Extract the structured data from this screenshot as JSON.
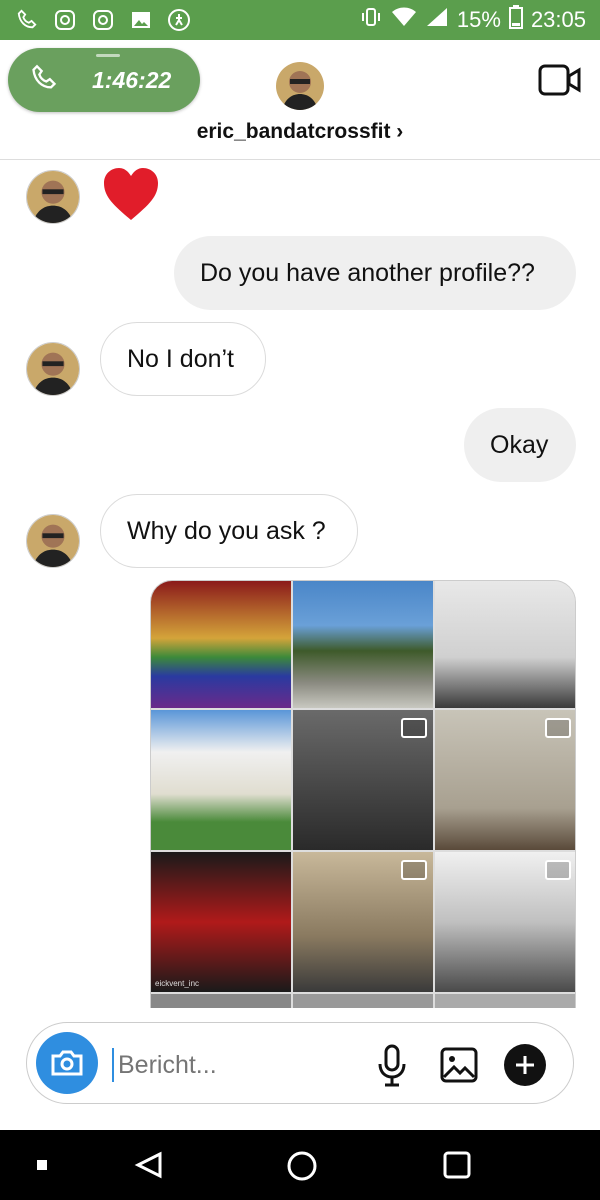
{
  "status_bar": {
    "battery": "15%",
    "time": "23:05",
    "icons": [
      "phone-icon",
      "instagram-icon",
      "instagram-icon",
      "image-icon",
      "walk-icon",
      "vibrate-icon",
      "wifi-icon",
      "signal-icon",
      "battery-icon"
    ]
  },
  "header": {
    "call_duration": "1:46:22",
    "username": "eric_bandatcrossfit ›"
  },
  "messages": [
    {
      "direction": "in",
      "type": "heart"
    },
    {
      "direction": "out",
      "text": "Do you have another profile??"
    },
    {
      "direction": "in",
      "text": "No I don’t"
    },
    {
      "direction": "out",
      "text": "Okay"
    },
    {
      "direction": "in",
      "text": "Why do you ask ?"
    },
    {
      "direction": "in",
      "type": "shared-profile-grid"
    }
  ],
  "grid": {
    "watermark": "eickvent_inc"
  },
  "composer": {
    "placeholder": "Bericht..."
  },
  "colors": {
    "status_bar": "#5b9e4d",
    "call_pill": "#6aa05e",
    "camera_button": "#2f8ee0",
    "out_bubble": "#efefef"
  }
}
